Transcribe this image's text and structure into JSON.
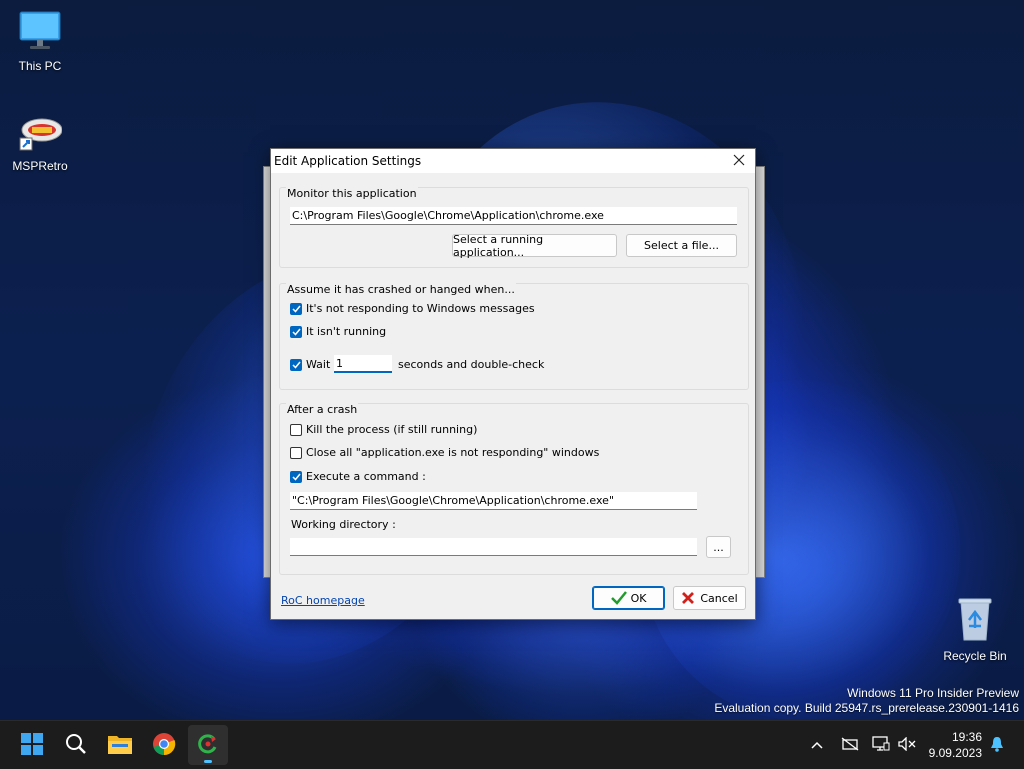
{
  "desktop": {
    "icons": [
      {
        "label": "This PC",
        "icon": "monitor-icon"
      },
      {
        "label": "MSPRetro",
        "icon": "msp-retro-shortcut-icon"
      },
      {
        "label": "Recycle Bin",
        "icon": "recycle-bin-icon"
      }
    ],
    "watermark": {
      "line1": "Windows 11 Pro Insider Preview",
      "line2": "Evaluation copy. Build 25947.rs_prerelease.230901-1416"
    }
  },
  "dialog": {
    "title": "Edit Application Settings",
    "monitor_group": {
      "label": "Monitor this application",
      "path_value": "C:\\Program Files\\Google\\Chrome\\Application\\chrome.exe",
      "select_running_label": "Select a running application...",
      "select_file_label": "Select a file..."
    },
    "crash_group": {
      "label": "Assume it has crashed or hanged when...",
      "not_responding_label": "It's not responding to Windows messages",
      "not_running_label": "It isn't running",
      "wait_label": "Wait",
      "wait_value": "1",
      "wait_suffix": "seconds and double-check"
    },
    "after_group": {
      "label": "After a crash",
      "kill_label": "Kill the process (if still running)",
      "close_all_label": "Close all \"application.exe is not responding\" windows",
      "execute_label": "Execute a command :",
      "command_value": "\"C:\\Program Files\\Google\\Chrome\\Application\\chrome.exe\"",
      "working_dir_label": "Working directory :",
      "working_dir_value": "",
      "browse_label": "..."
    },
    "footer": {
      "homepage_link": "RoC homepage",
      "ok_label": "OK",
      "cancel_label": "Cancel"
    },
    "checkboxes": {
      "not_responding": true,
      "not_running": true,
      "wait": true,
      "kill": false,
      "close_all": false,
      "execute": true
    }
  },
  "taskbar": {
    "apps": [
      "start-icon",
      "search-icon",
      "file-explorer-icon",
      "chrome-icon",
      "restart-on-crash-icon"
    ],
    "tray": [
      "chevron-up-icon",
      "network-icon",
      "display-icon",
      "speaker-muted-icon",
      "bell-icon"
    ],
    "clock_time": "19:36",
    "clock_date": "9.09.2023"
  },
  "colors": {
    "accent": "#0067c0",
    "taskbar": "#1c1c1c",
    "indicator": "#4cc2ff"
  }
}
